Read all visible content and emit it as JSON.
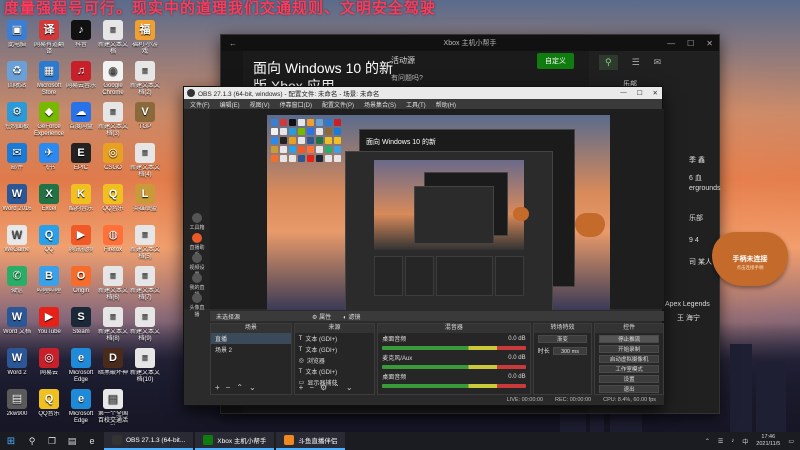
{
  "banner": {
    "text": "度量强程号可行。现实中的道理我们交通规则、文明安全驾驶"
  },
  "desktop": {
    "icons": [
      {
        "label": "此电脑",
        "color": "#3b7fd4",
        "glyph": "▣"
      },
      {
        "label": "网易有道翻译",
        "color": "#d23a3a",
        "glyph": "译"
      },
      {
        "label": "抖音",
        "color": "#111111",
        "glyph": "♪"
      },
      {
        "label": "新建文本文档",
        "color": "#e6e6e6",
        "glyph": "≡"
      },
      {
        "label": "福利·小游戏",
        "color": "#f0a030",
        "glyph": "福"
      },
      {
        "label": "回收站",
        "color": "#6aa0d8",
        "glyph": "♻"
      },
      {
        "label": "Microsoft Store",
        "color": "#2a7ad0",
        "glyph": "▦"
      },
      {
        "label": "网易云音乐",
        "color": "#c8202a",
        "glyph": "♫"
      },
      {
        "label": "Google Chrome",
        "color": "#f2f2f2",
        "glyph": "◉"
      },
      {
        "label": "新建文本文档(2)",
        "color": "#e6e6e6",
        "glyph": "≡"
      },
      {
        "label": "控制面板",
        "color": "#2b9ad8",
        "glyph": "⚙"
      },
      {
        "label": "GeForce Experience",
        "color": "#76b900",
        "glyph": "◆"
      },
      {
        "label": "百度网盘",
        "color": "#2a72e8",
        "glyph": "☁"
      },
      {
        "label": "新建文本文档(3)",
        "color": "#e6e6e6",
        "glyph": "≡"
      },
      {
        "label": "TGP",
        "color": "#8a6a3a",
        "glyph": "V"
      },
      {
        "label": "邮件",
        "color": "#1a7ad8",
        "glyph": "✉"
      },
      {
        "label": "飞书",
        "color": "#2a8af0",
        "glyph": "✈"
      },
      {
        "label": "EPIC",
        "color": "#222222",
        "glyph": "E"
      },
      {
        "label": "CSGO",
        "color": "#e8a020",
        "glyph": "◎"
      },
      {
        "label": "新建文本文档(4)",
        "color": "#e6e6e6",
        "glyph": "≡"
      },
      {
        "label": "Word 2016",
        "color": "#2b5797",
        "glyph": "W"
      },
      {
        "label": "Excel",
        "color": "#217346",
        "glyph": "X"
      },
      {
        "label": "酷狗音乐",
        "color": "#f0c020",
        "glyph": "K"
      },
      {
        "label": "QQ音乐",
        "color": "#f0c020",
        "glyph": "Q"
      },
      {
        "label": "英雄联盟",
        "color": "#c89a3a",
        "glyph": "L"
      },
      {
        "label": "WeGame",
        "color": "#e8e8e8",
        "glyph": "W"
      },
      {
        "label": "QQ",
        "color": "#2aa0e8",
        "glyph": "Q"
      },
      {
        "label": "腾讯视频",
        "color": "#f05a28",
        "glyph": "▶"
      },
      {
        "label": "Firefox",
        "color": "#ff7139",
        "glyph": "◍"
      },
      {
        "label": "新建文本文档(5)",
        "color": "#e6e6e6",
        "glyph": "≡"
      },
      {
        "label": "微信",
        "color": "#2aae67",
        "glyph": "✆"
      },
      {
        "label": "哔哩哔哩",
        "color": "#3aa0e8",
        "glyph": "B"
      },
      {
        "label": "Origin",
        "color": "#f56c2d",
        "glyph": "O"
      },
      {
        "label": "新建文本文档(6)",
        "color": "#e6e6e6",
        "glyph": "≡"
      },
      {
        "label": "新建文本文档(7)",
        "color": "#e6e6e6",
        "glyph": "≡"
      },
      {
        "label": "Word 文档",
        "color": "#2b5797",
        "glyph": "W"
      },
      {
        "label": "YouTube",
        "color": "#e62117",
        "glyph": "▶"
      },
      {
        "label": "Steam",
        "color": "#1b2838",
        "glyph": "S"
      },
      {
        "label": "新建文本文档(8)",
        "color": "#e6e6e6",
        "glyph": "≡"
      },
      {
        "label": "新建文本文档(9)",
        "color": "#e6e6e6",
        "glyph": "≡"
      },
      {
        "label": "Word 2",
        "color": "#2b5797",
        "glyph": "W"
      },
      {
        "label": "网易云",
        "color": "#c8202a",
        "glyph": "◎"
      },
      {
        "label": "Microsoft Edge",
        "color": "#1f8ad8",
        "glyph": "e"
      },
      {
        "label": "暗黑破坏神",
        "color": "#4a2a1a",
        "glyph": "D"
      },
      {
        "label": "新建文本文档(10)",
        "color": "#e6e6e6",
        "glyph": "≡"
      },
      {
        "label": "2kw900",
        "color": "#5a5a5a",
        "glyph": "▤"
      },
      {
        "label": "QQ音乐",
        "color": "#f0c020",
        "glyph": "Q"
      },
      {
        "label": "Microsoft Edge",
        "color": "#1f8ad8",
        "glyph": "e"
      },
      {
        "label": "第一个全国百校交通活动",
        "color": "#e8e8e8",
        "glyph": "▤"
      }
    ]
  },
  "xbox": {
    "title": "Xbox 主机小帮手",
    "heading_line1": "面向 Windows 10 的新",
    "heading_line2": "版 Xbox 应用",
    "activity": "活动源",
    "customize": "自定义",
    "question": "有问题吗?",
    "side_items": [
      "乐部",
      "季 鑫",
      "6 血",
      "ergrounds",
      "乐部",
      "9 4",
      "司 某人",
      "Apex Legends",
      "王 海宁"
    ]
  },
  "obs": {
    "title": "OBS 27.1.3 (64-bit, windows) - 配置文件: 未命名 - 场景: 未命名",
    "menu": [
      "文件(F)",
      "编辑(E)",
      "视图(V)",
      "停靠窗口(D)",
      "配置文件(P)",
      "场景集合(S)",
      "工具(T)",
      "帮助(H)"
    ],
    "no_source": "未选择源",
    "properties": "属性",
    "filters": "滤镜",
    "docks": {
      "scenes": {
        "title": "场景",
        "items": [
          "直播",
          "场景 2"
        ]
      },
      "sources": {
        "title": "来源",
        "items": [
          "文本 (GDI+)",
          "文本 (GDI+)",
          "浏览器",
          "文本 (GDI+)",
          "显示器捕获"
        ]
      },
      "mixer": {
        "title": "混音器",
        "items": [
          "桌面音频",
          "麦克风/Aux",
          "桌面音频"
        ],
        "levels": [
          "0.0 dB",
          "0.0 dB",
          "0.0 dB"
        ]
      },
      "transitions": {
        "title": "转场特效",
        "type": "渐变",
        "duration_label": "时长",
        "duration": "300 ms"
      },
      "controls": {
        "title": "控件",
        "buttons": [
          "停止推流",
          "开始录制",
          "启动虚拟摄像机",
          "工作室模式",
          "设置",
          "退出"
        ]
      }
    },
    "status": {
      "live": "LIVE: 00:00:00",
      "rec": "REC: 00:00:00",
      "cpu": "CPU: 8.4%, 60.00 fps"
    },
    "left_labels": [
      "工具箱",
      "直播助手",
      "视频设置",
      "我的直播",
      "头像直播"
    ]
  },
  "controller": {
    "title": "手柄未连接",
    "subtitle": "点击连接手柄"
  },
  "taskbar": {
    "tasks": [
      {
        "label": "OBS 27.1.3 (64-bit...",
        "color": "#333333"
      },
      {
        "label": "Xbox 主机小帮手",
        "color": "#107c10"
      },
      {
        "label": "斗鱼直播伴侣",
        "color": "#f08a20"
      }
    ],
    "time": "17:46",
    "date": "2021/11/5",
    "lang": "中"
  }
}
